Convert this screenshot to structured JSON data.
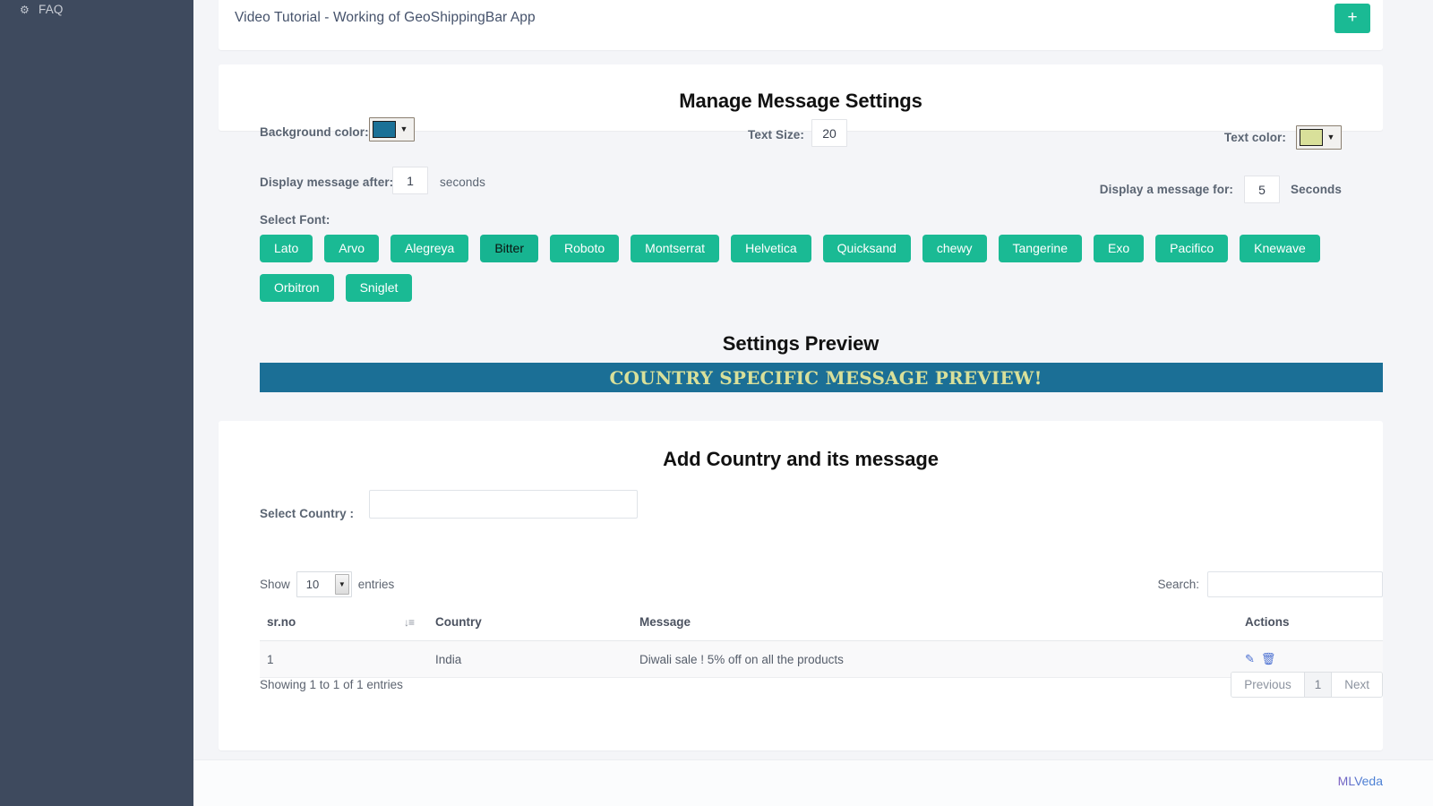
{
  "sidebar": {
    "items": [
      {
        "label": "FAQ",
        "icon": "gear-icon"
      }
    ]
  },
  "topbar": {
    "title": "Video Tutorial - Working of GeoShippingBar App",
    "add_label": "+"
  },
  "settings": {
    "heading": "Manage Message Settings",
    "background_color_label": "Background color:",
    "background_color_value": "#1b7197",
    "text_color_label": "Text color:",
    "text_color_value": "#d9e09a",
    "text_size_label": "Text Size:",
    "text_size_value": "20",
    "delay_label": "Display message after:",
    "delay_value": "1",
    "delay_unit": "seconds",
    "duration_label": "Display a message for:",
    "duration_value": "5",
    "duration_unit": "Seconds",
    "font_label": "Select Font:",
    "fonts": [
      {
        "name": "Lato",
        "active": false
      },
      {
        "name": "Arvo",
        "active": false
      },
      {
        "name": "Alegreya",
        "active": false
      },
      {
        "name": "Bitter",
        "active": true
      },
      {
        "name": "Roboto",
        "active": false
      },
      {
        "name": "Montserrat",
        "active": false
      },
      {
        "name": "Helvetica",
        "active": false
      },
      {
        "name": "Quicksand",
        "active": false
      },
      {
        "name": "chewy",
        "active": false
      },
      {
        "name": "Tangerine",
        "active": false
      },
      {
        "name": "Exo",
        "active": false
      },
      {
        "name": "Pacifico",
        "active": false
      },
      {
        "name": "Knewave",
        "active": false
      },
      {
        "name": "Orbitron",
        "active": false
      },
      {
        "name": "Sniglet",
        "active": false
      }
    ],
    "preview_heading": "Settings Preview",
    "preview_text": "COUNTRY SPECIFIC MESSAGE PREVIEW!"
  },
  "country_section": {
    "heading": "Add Country and its message",
    "select_country_label": "Select Country :",
    "select_country_value": "",
    "select_country_placeholder": "",
    "datatable": {
      "show_label": "Show",
      "entries_label": "entries",
      "page_length": "10",
      "search_label": "Search:",
      "search_value": "",
      "search_placeholder": "",
      "columns": [
        "sr.no",
        "Country",
        "Message",
        "Actions"
      ],
      "rows": [
        {
          "srno": "1",
          "country": "India",
          "message": "Diwali sale ! 5% off on all the products",
          "actions": [
            "edit-icon",
            "delete-icon"
          ]
        }
      ],
      "info": "Showing 1 to 1 of 1 entries",
      "pagination": {
        "previous": "Previous",
        "pages": [
          "1"
        ],
        "next": "Next",
        "current": "1"
      }
    }
  },
  "footer": {
    "brand": "MLVeda"
  },
  "colors": {
    "sidebar_bg": "#3e4a5e",
    "accent_green": "#1aba94",
    "banner_blue": "#1b6f96",
    "banner_text": "#d9e09a",
    "page_bg": "#f4f5f8"
  }
}
